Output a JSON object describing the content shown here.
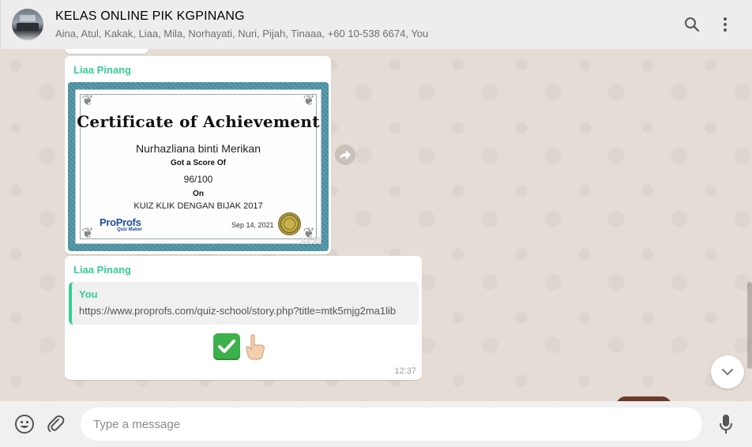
{
  "header": {
    "title": "KELAS ONLINE PIK KGPINANG",
    "members": "Aina, Atul, Kakak, Liaa, Mila, Norhayati, Nuri, Pijah, Tinaaa, +60 10-538 6674, You",
    "icons": [
      "search-icon",
      "menu-icon"
    ]
  },
  "messages": [
    {
      "sender": "Liaa Pinang",
      "type": "image",
      "time": "12:37",
      "certificate": {
        "title": "Certificate of Achievement",
        "name": "Nurhazliana binti Merikan",
        "got_score_label": "Got a Score Of",
        "score": "96/100",
        "on_label": "On",
        "quiz": "KUIZ KLIK DENGAN BIJAK 2017",
        "logo_main": "ProProfs",
        "logo_sub": "Quiz Maker",
        "date": "Sep 14, 2021"
      }
    },
    {
      "sender": "Liaa Pinang",
      "type": "reply",
      "time": "12:37",
      "quoted_author": "You",
      "quoted_text": "https://www.proprofs.com/quiz-school/story.php?title=mtk5mjg2ma1lib",
      "body_emojis": [
        "✔",
        "👆"
      ]
    }
  ],
  "composer": {
    "placeholder": "Type a message",
    "icons": [
      "emoji-icon",
      "paperclip-icon",
      "microphone-icon"
    ]
  },
  "colors": {
    "sender": "#35cd96",
    "chat_bg": "#e5ddd5",
    "header_bg": "#ededed"
  }
}
